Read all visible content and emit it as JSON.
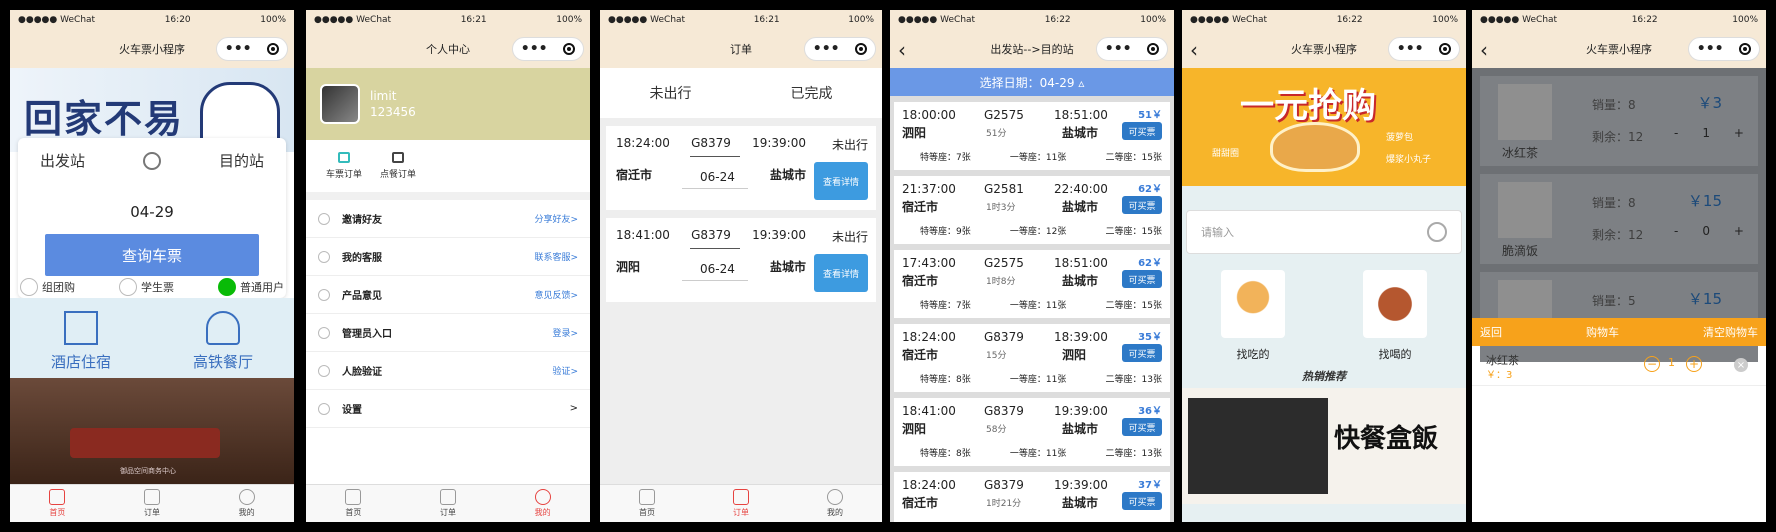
{
  "status": {
    "carrier": "●●●●● WeChat",
    "battery": "100%"
  },
  "p1": {
    "time": "16:20",
    "title": "火车票小程序",
    "banner_text": "回家不易",
    "from": "出发站",
    "to": "目的站",
    "date": "04-29",
    "query_btn": "查询车票",
    "options": [
      "组团购",
      "学生票",
      "普通用户"
    ],
    "services": [
      "酒店住宿",
      "高铁餐厅"
    ],
    "photo_caption": "御品空间商务中心",
    "tabs": [
      "首页",
      "订单",
      "我的"
    ]
  },
  "p2": {
    "time": "16:21",
    "title": "个人中心",
    "name": "limit",
    "uid": "123456",
    "orders": [
      "车票订单",
      "点餐订单"
    ],
    "menu": [
      {
        "label": "邀请好友",
        "action": "分享好友>"
      },
      {
        "label": "我的客服",
        "action": "联系客服>"
      },
      {
        "label": "产品意见",
        "action": "意见反馈>"
      },
      {
        "label": "管理员入口",
        "action": "登录>"
      },
      {
        "label": "人脸验证",
        "action": "验证>"
      },
      {
        "label": "设置",
        "action": ">"
      }
    ],
    "tabs": [
      "首页",
      "订单",
      "我的"
    ]
  },
  "p3": {
    "time": "16:21",
    "title": "订单",
    "segments": [
      "未出行",
      "已完成"
    ],
    "tickets": [
      {
        "dep": "18:24:00",
        "train": "G8379",
        "arr": "19:39:00",
        "status": "未出行",
        "from": "宿迁市",
        "date": "06-24",
        "to": "盐城市",
        "btn": "查看详情"
      },
      {
        "dep": "18:41:00",
        "train": "G8379",
        "arr": "19:39:00",
        "status": "未出行",
        "from": "泗阳",
        "date": "06-24",
        "to": "盐城市",
        "btn": "查看详情"
      }
    ],
    "tabs": [
      "首页",
      "订单",
      "我的"
    ]
  },
  "p4": {
    "time": "16:22",
    "title": "出发站-->目的站",
    "date_bar": "选择日期：04-29 ▵",
    "trains": [
      {
        "dep": "18:00:00",
        "no": "G2575",
        "arr": "18:51:00",
        "price": "51￥",
        "from": "泗阳",
        "dur": "51分",
        "to": "盐城市",
        "buy": "可买票",
        "s1": "特等座：7张",
        "s2": "一等座：11张",
        "s3": "二等座：15张"
      },
      {
        "dep": "21:37:00",
        "no": "G2581",
        "arr": "22:40:00",
        "price": "62￥",
        "from": "宿迁市",
        "dur": "1时3分",
        "to": "盐城市",
        "buy": "可买票",
        "s1": "特等座：9张",
        "s2": "一等座：12张",
        "s3": "二等座：15张"
      },
      {
        "dep": "17:43:00",
        "no": "G2575",
        "arr": "18:51:00",
        "price": "62￥",
        "from": "宿迁市",
        "dur": "1时8分",
        "to": "盐城市",
        "buy": "可买票",
        "s1": "特等座：7张",
        "s2": "一等座：11张",
        "s3": "二等座：15张"
      },
      {
        "dep": "18:24:00",
        "no": "G8379",
        "arr": "18:39:00",
        "price": "35￥",
        "from": "宿迁市",
        "dur": "15分",
        "to": "泗阳",
        "buy": "可买票",
        "s1": "特等座：8张",
        "s2": "一等座：11张",
        "s3": "二等座：13张"
      },
      {
        "dep": "18:41:00",
        "no": "G8379",
        "arr": "19:39:00",
        "price": "36￥",
        "from": "泗阳",
        "dur": "58分",
        "to": "盐城市",
        "buy": "可买票",
        "s1": "特等座：8张",
        "s2": "一等座：11张",
        "s3": "二等座：13张"
      },
      {
        "dep": "18:24:00",
        "no": "G8379",
        "arr": "19:39:00",
        "price": "37￥",
        "from": "宿迁市",
        "dur": "1时21分",
        "to": "盐城市",
        "buy": "可买票",
        "s1": "特等座：8张",
        "s2": "一等座：11张",
        "s3": "二等座：13张"
      }
    ]
  },
  "p5": {
    "time": "16:22",
    "title": "火车票小程序",
    "promo": "一元抢购",
    "promo_labels": [
      "菠萝包",
      "甜甜圈",
      "爆浆小丸子"
    ],
    "search_placeholder": "请输入",
    "foods": [
      "找吃的",
      "找喝的"
    ],
    "hot": "热销推荐",
    "bento": "快餐盒飯"
  },
  "p6": {
    "time": "16:22",
    "title": "火车票小程序",
    "products": [
      {
        "name": "冰红茶",
        "sales": "销量：8",
        "left": "剩余：12",
        "price": "￥3",
        "qty": "1"
      },
      {
        "name": "脆滴饭",
        "sales": "销量：8",
        "left": "剩余：12",
        "price": "￥15",
        "qty": "0"
      },
      {
        "name": "",
        "sales": "销量：5",
        "left": "",
        "price": "￥15",
        "qty": ""
      }
    ],
    "cart": {
      "back": "返回",
      "title": "购物车",
      "clear": "清空购物车"
    },
    "cart_item": {
      "name": "冰红茶",
      "price": "￥：3",
      "count": "1"
    }
  }
}
